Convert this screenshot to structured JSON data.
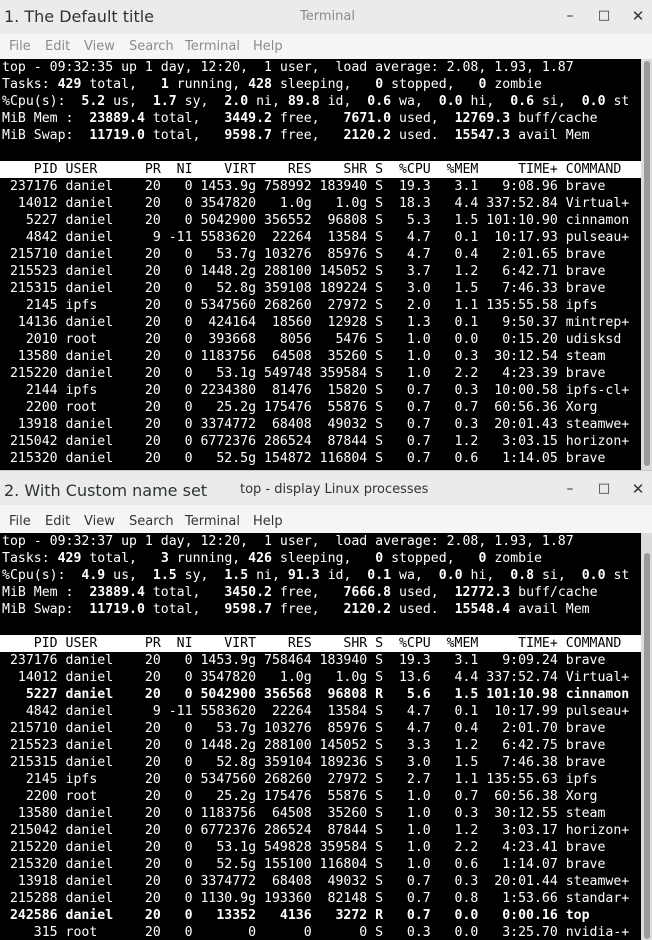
{
  "windows": [
    {
      "title": "1. The Default title",
      "terminal_title": "Terminal",
      "controls": {
        "minimize": "–",
        "maximize": "□",
        "close": "✕"
      },
      "menu": [
        "File",
        "Edit",
        "View",
        "Search",
        "Terminal",
        "Help"
      ],
      "summary": {
        "uptime_line": "top - 09:32:35 up 1 day, 12:20,  1 user,  load average: 2.08, 1.93, 1.87",
        "tasks": [
          "429",
          "1",
          "428",
          "0",
          "0"
        ],
        "cpu": [
          "5.2",
          "1.7",
          "2.0",
          "89.8",
          "0.6",
          "0.0",
          "0.6",
          "0.0"
        ],
        "mem": [
          "23889.4",
          "3449.2",
          "7671.0",
          "12769.3"
        ],
        "swap": [
          "11719.0",
          "9598.7",
          "2120.2",
          "15547.3"
        ]
      },
      "header": "    PID USER      PR  NI    VIRT    RES    SHR S  %CPU  %MEM     TIME+ COMMAND",
      "processes": [
        {
          "text": " 237176 daniel    20   0 1453.9g 758992 183940 S  19.3   3.1   9:08.96 brave",
          "bold": false
        },
        {
          "text": "  14012 daniel    20   0 3547820   1.0g   1.0g S  18.3   4.4 337:52.84 Virtual+",
          "bold": false
        },
        {
          "text": "   5227 daniel    20   0 5042900 356552  96808 S   5.3   1.5 101:10.90 cinnamon",
          "bold": false
        },
        {
          "text": "   4842 daniel     9 -11 5583620  22264  13584 S   4.7   0.1  10:17.93 pulseau+",
          "bold": false
        },
        {
          "text": " 215710 daniel    20   0   53.7g 103276  85976 S   4.7   0.4   2:01.65 brave",
          "bold": false
        },
        {
          "text": " 215523 daniel    20   0 1448.2g 288100 145052 S   3.7   1.2   6:42.71 brave",
          "bold": false
        },
        {
          "text": " 215315 daniel    20   0   52.8g 359108 189224 S   3.0   1.5   7:46.33 brave",
          "bold": false
        },
        {
          "text": "   2145 ipfs      20   0 5347560 268260  27972 S   2.0   1.1 135:55.58 ipfs",
          "bold": false
        },
        {
          "text": "  14136 daniel    20   0  424164  18560  12928 S   1.3   0.1   9:50.37 mintrep+",
          "bold": false
        },
        {
          "text": "   2010 root      20   0  393668   8056   5476 S   1.0   0.0   0:15.20 udisksd",
          "bold": false
        },
        {
          "text": "  13580 daniel    20   0 1183756  64508  35260 S   1.0   0.3  30:12.54 steam",
          "bold": false
        },
        {
          "text": " 215220 daniel    20   0   53.1g 549748 359584 S   1.0   2.2   4:23.39 brave",
          "bold": false
        },
        {
          "text": "   2144 ipfs      20   0 2234380  81476  15820 S   0.7   0.3  10:00.58 ipfs-cl+",
          "bold": false
        },
        {
          "text": "   2200 root      20   0   25.2g 175476  55876 S   0.7   0.7  60:56.36 Xorg",
          "bold": false
        },
        {
          "text": "  13918 daniel    20   0 3374772  68408  49032 S   0.7   0.3  20:01.43 steamwe+",
          "bold": false
        },
        {
          "text": " 215042 daniel    20   0 6772376 286524  87844 S   0.7   1.2   3:03.15 horizon+",
          "bold": false
        },
        {
          "text": " 215320 daniel    20   0   52.5g 154872 116804 S   0.7   0.6   1:14.05 brave",
          "bold": false
        }
      ]
    },
    {
      "title": "2. With Custom name set",
      "terminal_title": "top - display Linux processes",
      "controls": {
        "minimize": "–",
        "maximize": "□",
        "close": "✕"
      },
      "menu": [
        "File",
        "Edit",
        "View",
        "Search",
        "Terminal",
        "Help"
      ],
      "summary": {
        "uptime_line": "top - 09:32:37 up 1 day, 12:20,  1 user,  load average: 2.08, 1.93, 1.87",
        "tasks": [
          "429",
          "3",
          "426",
          "0",
          "0"
        ],
        "cpu": [
          "4.9",
          "1.5",
          "1.5",
          "91.3",
          "0.1",
          "0.0",
          "0.8",
          "0.0"
        ],
        "mem": [
          "23889.4",
          "3450.2",
          "7666.8",
          "12772.3"
        ],
        "swap": [
          "11719.0",
          "9598.7",
          "2120.2",
          "15548.4"
        ]
      },
      "header": "    PID USER      PR  NI    VIRT    RES    SHR S  %CPU  %MEM     TIME+ COMMAND",
      "processes": [
        {
          "text": " 237176 daniel    20   0 1453.9g 758464 183940 S  19.3   3.1   9:09.24 brave",
          "bold": false
        },
        {
          "text": "  14012 daniel    20   0 3547820   1.0g   1.0g S  13.6   4.4 337:52.74 Virtual+",
          "bold": false
        },
        {
          "text": "   5227 daniel    20   0 5042900 356568  96808 R   5.6   1.5 101:10.98 cinnamon",
          "bold": true
        },
        {
          "text": "   4842 daniel     9 -11 5583620  22264  13584 S   4.7   0.1  10:17.99 pulseau+",
          "bold": false
        },
        {
          "text": " 215710 daniel    20   0   53.7g 103276  85976 S   4.7   0.4   2:01.70 brave",
          "bold": false
        },
        {
          "text": " 215523 daniel    20   0 1448.2g 288100 145052 S   3.3   1.2   6:42.75 brave",
          "bold": false
        },
        {
          "text": " 215315 daniel    20   0   52.8g 359104 189236 S   3.0   1.5   7:46.38 brave",
          "bold": false
        },
        {
          "text": "   2145 ipfs      20   0 5347560 268260  27972 S   2.7   1.1 135:55.63 ipfs",
          "bold": false
        },
        {
          "text": "   2200 root      20   0   25.2g 175476  55876 S   1.0   0.7  60:56.38 Xorg",
          "bold": false
        },
        {
          "text": "  13580 daniel    20   0 1183756  64508  35260 S   1.0   0.3  30:12.55 steam",
          "bold": false
        },
        {
          "text": " 215042 daniel    20   0 6772376 286524  87844 S   1.0   1.2   3:03.17 horizon+",
          "bold": false
        },
        {
          "text": " 215220 daniel    20   0   53.1g 549828 359584 S   1.0   2.2   4:23.41 brave",
          "bold": false
        },
        {
          "text": " 215320 daniel    20   0   52.5g 155100 116804 S   1.0   0.6   1:14.07 brave",
          "bold": false
        },
        {
          "text": "  13918 daniel    20   0 3374772  68408  49032 S   0.7   0.3  20:01.44 steamwe+",
          "bold": false
        },
        {
          "text": " 215288 daniel    20   0 1130.9g 193360  82148 S   0.7   0.8   1:53.66 standar+",
          "bold": false
        },
        {
          "text": " 242586 daniel    20   0   13352   4136   3272 R   0.7   0.0   0:00.16 top",
          "bold": true
        },
        {
          "text": "    315 root      20   0       0      0      0 S   0.3   0.0   3:25.70 nvidia-+",
          "bold": false
        }
      ]
    }
  ]
}
